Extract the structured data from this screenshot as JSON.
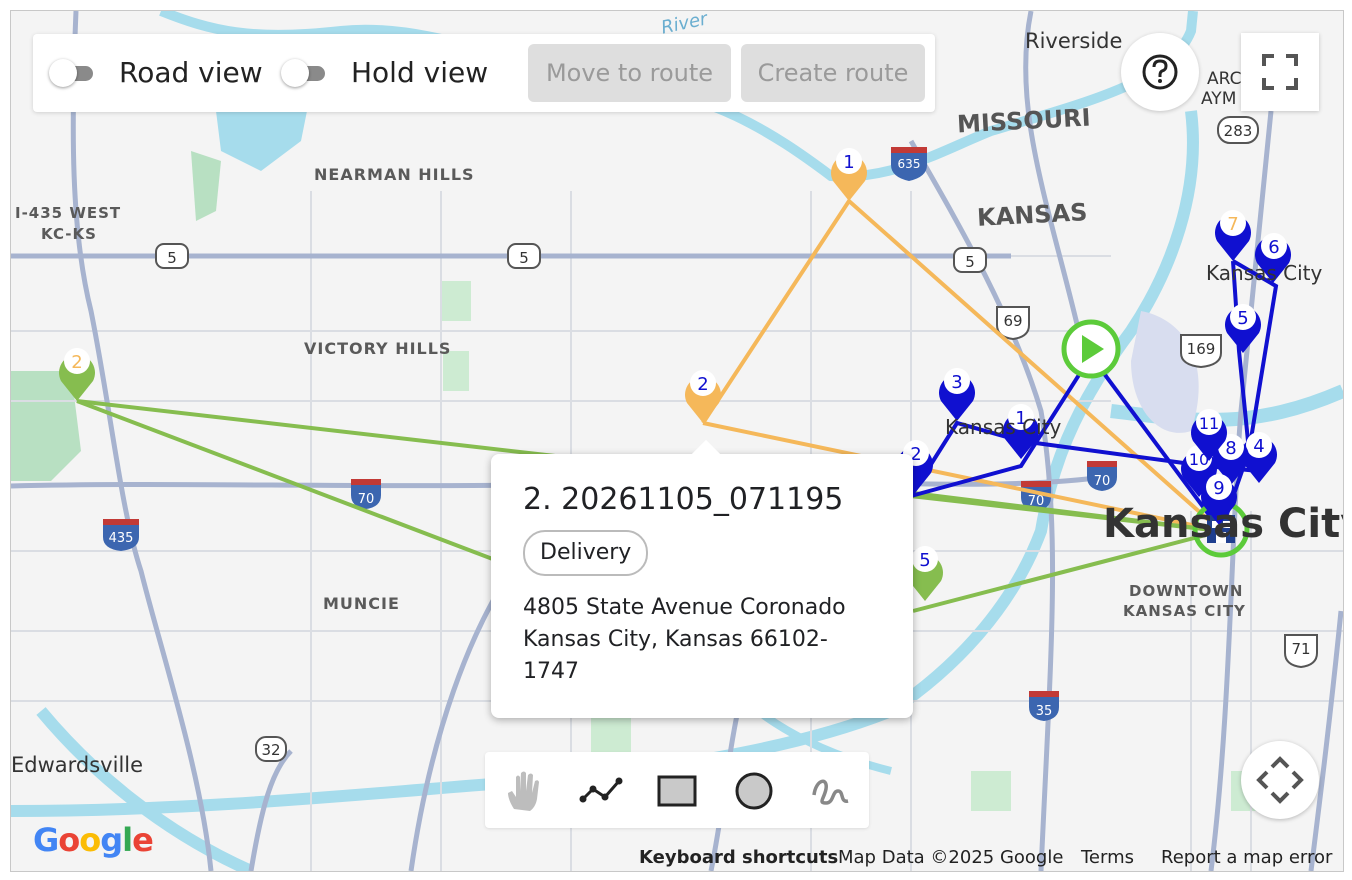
{
  "toolbar": {
    "road_view_label": "Road view",
    "hold_view_label": "Hold view",
    "move_to_route_label": "Move to route",
    "create_route_label": "Create route"
  },
  "popup": {
    "title": "2. 20261105_071195",
    "chip": "Delivery",
    "address": "4805 State Avenue Coronado Kansas City, Kansas 66102-1747"
  },
  "map_labels": {
    "riverside": "Riverside",
    "missouri": "MISSOURI",
    "kansas": "KANSAS",
    "nearman_hills": "NEARMAN HILLS",
    "i435_west_line1": "I-435 WEST",
    "i435_west_line2": "KC-KS",
    "victory_hills": "VICTORY HILLS",
    "muncie": "MUNCIE",
    "edwardsville": "Edwardsville",
    "downtown_line1": "DOWNTOWN",
    "downtown_line2": "KANSAS CITY",
    "kansas_city_small_1": "Kansas City",
    "kansas_city_small_2": "Kansas City",
    "kansas_city_big": "Kansas City",
    "claymont": "ARCL",
    "claymont2": "AYM",
    "river": "River"
  },
  "road_shields": {
    "r5a": "5",
    "r5b": "5",
    "r5c": "5",
    "r635": "635",
    "r69": "69",
    "r169": "169",
    "r283": "283",
    "r70a": "70",
    "r70b": "70",
    "r70c": "70",
    "r435": "435",
    "r32": "32",
    "r35": "35",
    "r71": "71"
  },
  "markers": {
    "orange_1": "1",
    "orange_2": "2",
    "orange_7": "7",
    "green_2": "2",
    "green_5": "5",
    "blue_1": "1",
    "blue_2": "2",
    "blue_3": "3",
    "blue_4": "4",
    "blue_5": "5",
    "blue_6": "6",
    "blue_8": "8",
    "blue_9": "9",
    "blue_10": "10",
    "blue_11": "11"
  },
  "colors": {
    "orange_route": "#f5b85a",
    "green_route": "#86bd4f",
    "blue_route": "#1010d0",
    "start_green": "#5ccb3a"
  },
  "footer": {
    "keyboard_shortcuts": "Keyboard shortcuts",
    "map_data": "Map Data ©2025 Google",
    "terms": "Terms",
    "report": "Report a map error"
  },
  "logo": "Google",
  "icons": {
    "help": "help-icon",
    "fullscreen": "fullscreen-icon",
    "pan": "pan-arrows-icon",
    "hand": "hand-icon",
    "polyline": "polyline-icon",
    "rectangle": "rectangle-icon",
    "circle": "circle-icon",
    "freehand": "freehand-icon"
  }
}
